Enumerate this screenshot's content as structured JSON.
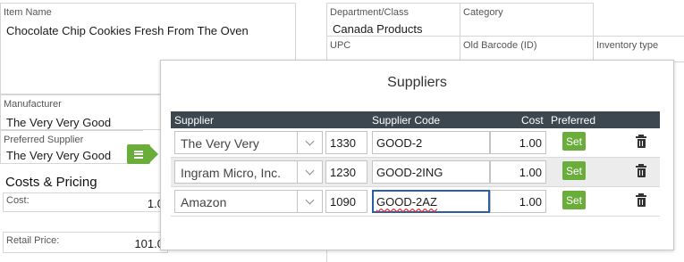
{
  "form": {
    "item_name": {
      "label": "Item Name",
      "value": "Chocolate Chip Cookies Fresh From The Oven"
    },
    "manufacturer": {
      "label": "Manufacturer",
      "value": "The Very Very Good"
    },
    "preferred_supplier": {
      "label": "Preferred Supplier",
      "value": "The Very Very Good"
    },
    "department": {
      "label": "Department/Class",
      "value": "Canada Products"
    },
    "category": {
      "label": "Category",
      "value": ""
    },
    "upc": {
      "label": "UPC",
      "value": ""
    },
    "old_barcode": {
      "label": "Old Barcode (ID)",
      "value": ""
    },
    "inventory_type": {
      "label": "Inventory type",
      "value": ""
    },
    "costs_title": "Costs & Pricing",
    "cost": {
      "label": "Cost:",
      "value": "1.0"
    },
    "retail_price": {
      "label": "Retail Price:",
      "value": "101.0"
    }
  },
  "modal": {
    "title": "Suppliers",
    "columns": {
      "supplier": "Supplier",
      "code": "Supplier Code",
      "cost": "Cost",
      "preferred": "Preferred"
    },
    "rows": [
      {
        "supplier": "The Very Very",
        "number": "1330",
        "code": "GOOD-2",
        "cost": "1.00",
        "set_label": "Set"
      },
      {
        "supplier": "Ingram Micro, Inc.",
        "number": "1230",
        "code": "GOOD-2ING",
        "cost": "1.00",
        "set_label": "Set"
      },
      {
        "supplier": "Amazon",
        "number": "1090",
        "code": "GOOD-2AZ",
        "cost": "1.00",
        "set_label": "Set"
      }
    ]
  },
  "colors": {
    "accent_green": "#6aad3a",
    "header_dark": "#3d4750",
    "focus_blue": "#2c5da8"
  }
}
